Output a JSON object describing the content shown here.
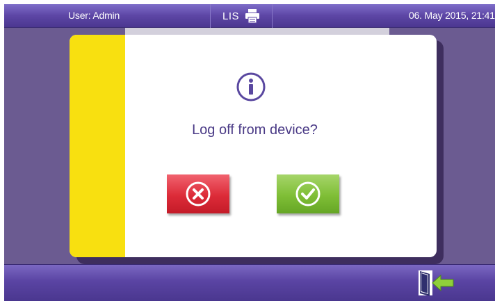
{
  "header": {
    "user_label": "User: Admin",
    "lis_label": "LIS",
    "printer_icon": "printer-icon",
    "datetime": "06. May 2015, 21:41"
  },
  "dialog": {
    "info_icon": "info-icon",
    "message": "Log off from device?",
    "cancel_icon": "cancel-x-icon",
    "confirm_icon": "confirm-check-icon"
  },
  "footer": {
    "logout_icon": "logout-door-icon"
  },
  "colors": {
    "bar_purple": "#5d46a5",
    "background_purple": "#6b5b91",
    "accent_yellow": "#f8e010",
    "text_purple": "#4a3a86",
    "cancel_red": "#dc2b38",
    "confirm_green": "#7fbe36",
    "logout_arrow_green": "#8fcf3a"
  }
}
